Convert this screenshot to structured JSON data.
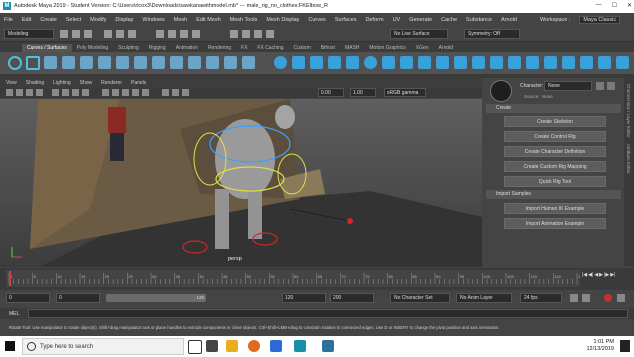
{
  "titlebar": {
    "title": "Autodesk Maya 2019 - Student Version: C:\\Users\\rlcox3\\Downloads\\sawkanawithmodel.mb*   ---   male_rig_no_clothes:FKElbow_R",
    "minimize": "—",
    "maximize": "☐",
    "close": "✕"
  },
  "menu": [
    "File",
    "Edit",
    "Create",
    "Select",
    "Modify",
    "Display",
    "Windows",
    "Mesh",
    "Edit Mesh",
    "Mesh Tools",
    "Mesh Display",
    "Curves",
    "Surfaces",
    "Deform",
    "UV",
    "Generate",
    "Cache",
    "Substance",
    "Arnold"
  ],
  "workspace": {
    "label": "Workspace :",
    "value": "Maya Classic"
  },
  "status_line": {
    "mode": "Modeling",
    "live_surface": "No Live Surface",
    "symmetry": "Symmetry: Off"
  },
  "shelf_tabs": [
    "Curves / Surfaces",
    "Poly Modeling",
    "Sculpting",
    "Rigging",
    "Animation",
    "Rendering",
    "FX",
    "FX Caching",
    "Custom",
    "Bifrost",
    "MASH",
    "Motion Graphics",
    "XGen",
    "Arnold"
  ],
  "shelf_active": "Curves / Surfaces",
  "viewport_menu": [
    "View",
    "Shading",
    "Lighting",
    "Show",
    "Renderer",
    "Panels"
  ],
  "viewport_tools": {
    "value_a": "0.00",
    "value_b": "1.00",
    "color_space": "sRGB gamma"
  },
  "viewport_label": "persp",
  "hik": {
    "character_label": "Character:",
    "character_value": "None",
    "source_label": "Source:",
    "source_value": "None",
    "create_header": "Create",
    "create_buttons": [
      "Create Skeleton",
      "Create Control Rig",
      "Create Character Definition",
      "Create Custom Rig Mapping",
      "Quick Rig Tool"
    ],
    "import_header": "Import Samples",
    "import_buttons": [
      "Import Human IK Example",
      "Import Animation Example"
    ]
  },
  "side_tabs": [
    "Channel Box / Layer Editor",
    "Attribute Editor",
    "Modeling Toolkit",
    "Tool Settings"
  ],
  "timeline": {
    "labels": [
      "0",
      "5",
      "10",
      "15",
      "20",
      "25",
      "30",
      "35",
      "40",
      "45",
      "50",
      "55",
      "60",
      "65",
      "70",
      "75",
      "80",
      "85",
      "90",
      "95",
      "100",
      "105",
      "110",
      "115",
      "120"
    ],
    "current_frame": "0"
  },
  "range": {
    "start": "0",
    "anim_start": "0",
    "range_value": "120",
    "anim_end": "120",
    "end": "200",
    "character_set": "No Character Set",
    "anim_layer": "No Anim Layer",
    "fps": "24 fps"
  },
  "mel_label": "MEL",
  "help_line": "Rotate Tool: Use manipulator to rotate object(s). Shift+drag manipulator axis or plane handles to extrude components or clone objects. Ctrl+Shift+LMB+drag to constrain rotation to connected edges. Use D or INSERT to change the pivot position and axis orientation.",
  "taskbar": {
    "search_placeholder": "Type here to search",
    "time": "1:01 PM",
    "date": "12/13/2019"
  }
}
